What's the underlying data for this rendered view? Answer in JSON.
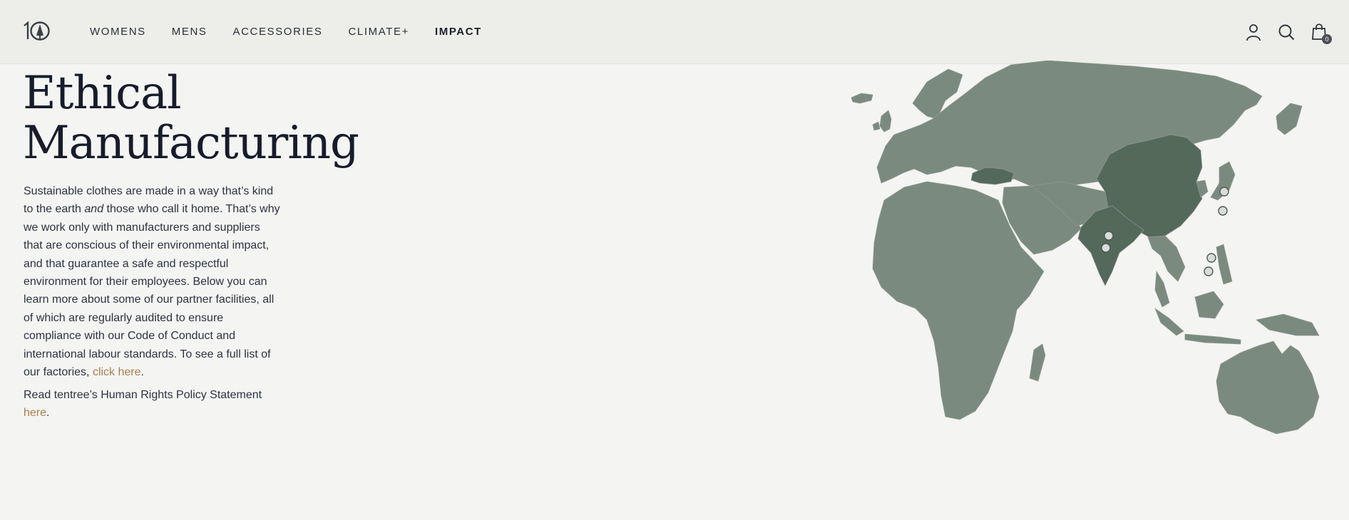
{
  "header": {
    "logo_alt": "10",
    "nav": [
      {
        "label": "WOMENS"
      },
      {
        "label": "MENS"
      },
      {
        "label": "ACCESSORIES"
      },
      {
        "label": "CLIMATE+"
      },
      {
        "label": "IMPACT",
        "active": true
      }
    ],
    "icons": [
      "account-icon",
      "search-icon",
      "cart-icon"
    ],
    "cart_count": "0"
  },
  "hero": {
    "title_line1": "Ethical",
    "title_line2": "Manufacturing",
    "body_part1": "Sustainable clothes are made in a way that’s kind to the earth ",
    "body_em": "and",
    "body_part2": " those who call it home. That’s why we work only with manufacturers and suppliers that are conscious of their environmental impact, and that guarantee a safe and respectful environment for their employees. Below you can learn more about some of our partner facilities, all of which are regularly audited to ensure compliance with our Code of Conduct and international labour standards. To see a full list of our factories, ",
    "body_link": "click here",
    "body_end": ".",
    "policy_text": "Read tentree’s Human Rights Policy Statement ",
    "policy_link": "here",
    "policy_end": "."
  },
  "map": {
    "land_color": "#7b8a7e",
    "highlight_color": "#55695b",
    "highlighted_regions": [
      "turkey",
      "india",
      "china"
    ],
    "marker_count": 6
  },
  "colors": {
    "background": "#f4f4f2",
    "header": "#edeee9",
    "link": "#a97f4d",
    "title": "#161c2b"
  }
}
